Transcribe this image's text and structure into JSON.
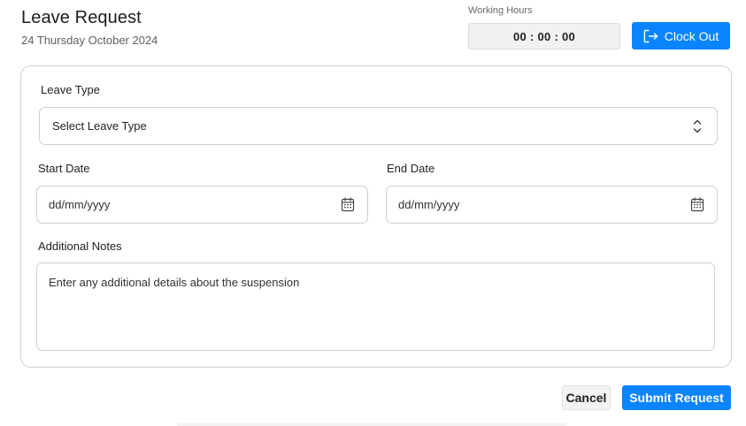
{
  "header": {
    "title": "Leave Request",
    "date": "24 Thursday October 2024"
  },
  "working_hours": {
    "label": "Working Hours",
    "timer": "00 : 00 : 00"
  },
  "clock_out": {
    "label": "Clock Out",
    "icon": "logout-icon"
  },
  "form": {
    "leave_type": {
      "label": "Leave Type",
      "value": "Select Leave Type",
      "icon": "chevron-up-down-icon"
    },
    "start_date": {
      "label": "Start Date",
      "placeholder": "dd/mm/yyyy",
      "icon": "calendar-icon"
    },
    "end_date": {
      "label": "End Date",
      "placeholder": "dd/mm/yyyy",
      "icon": "calendar-icon"
    },
    "notes": {
      "label": "Additional Notes",
      "placeholder": "Enter any additional details about the suspension"
    }
  },
  "actions": {
    "cancel": "Cancel",
    "submit": "Submit Request"
  },
  "colors": {
    "primary": "#0b84ff",
    "border": "#cfcfcf",
    "text": "#222222",
    "muted": "#5f5f5f"
  }
}
